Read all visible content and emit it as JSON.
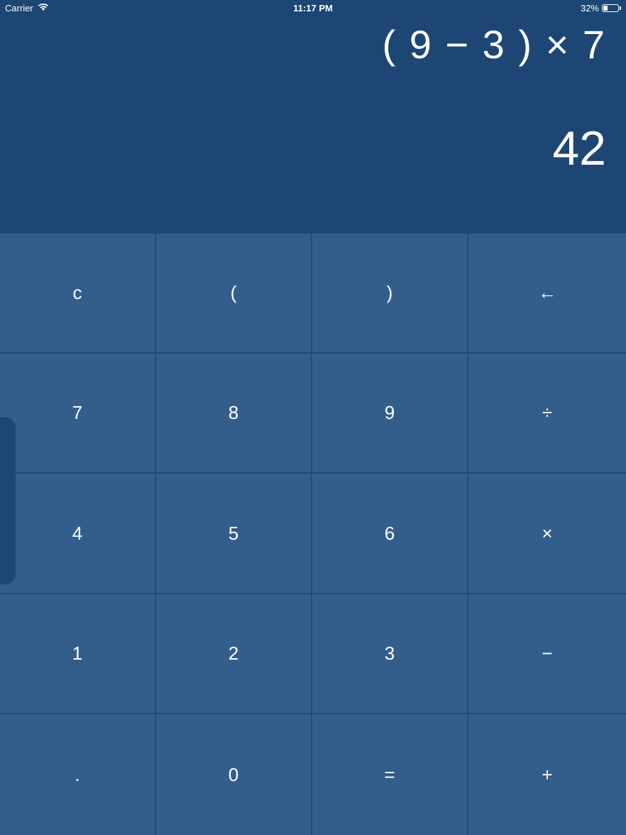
{
  "status_bar": {
    "carrier": "Carrier",
    "time": "11:17 PM",
    "battery_text": "32%",
    "battery_level": 0.32,
    "icons": [
      "wifi-icon",
      "battery-icon"
    ]
  },
  "display": {
    "expression": "( 9 − 3 ) × 7",
    "result": "42"
  },
  "keypad": {
    "keys": [
      {
        "label": "c",
        "name": "clear-button"
      },
      {
        "label": "(",
        "name": "open-paren-button"
      },
      {
        "label": ")",
        "name": "close-paren-button"
      },
      {
        "label": "←",
        "name": "backspace-button"
      },
      {
        "label": "7",
        "name": "digit-7-button"
      },
      {
        "label": "8",
        "name": "digit-8-button"
      },
      {
        "label": "9",
        "name": "digit-9-button"
      },
      {
        "label": "÷",
        "name": "divide-button"
      },
      {
        "label": "4",
        "name": "digit-4-button"
      },
      {
        "label": "5",
        "name": "digit-5-button"
      },
      {
        "label": "6",
        "name": "digit-6-button"
      },
      {
        "label": "×",
        "name": "multiply-button"
      },
      {
        "label": "1",
        "name": "digit-1-button"
      },
      {
        "label": "2",
        "name": "digit-2-button"
      },
      {
        "label": "3",
        "name": "digit-3-button"
      },
      {
        "label": "−",
        "name": "subtract-button"
      },
      {
        "label": ".",
        "name": "decimal-button"
      },
      {
        "label": "0",
        "name": "digit-0-button"
      },
      {
        "label": "=",
        "name": "equals-button"
      },
      {
        "label": "+",
        "name": "add-button"
      }
    ]
  },
  "colors": {
    "display_background": "#1d4674",
    "key_background": "#335e8c",
    "key_border": "#204a77",
    "text": "#ffffff"
  }
}
